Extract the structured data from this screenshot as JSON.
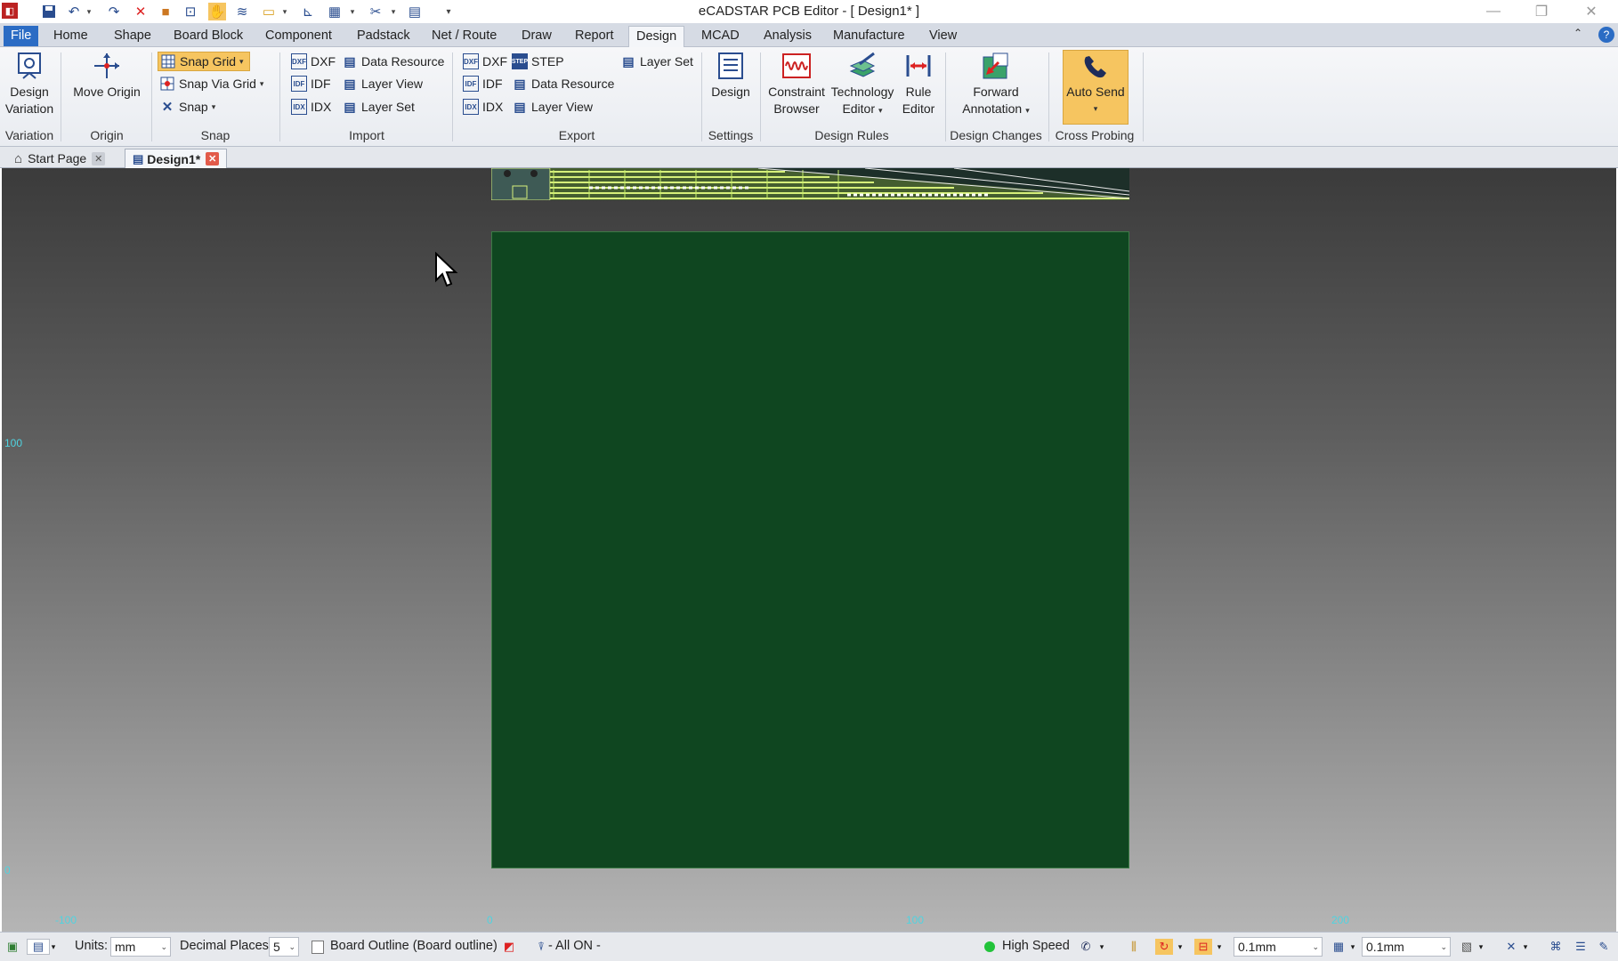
{
  "window": {
    "title": "eCADSTAR PCB Editor - [ Design1* ]"
  },
  "menu": [
    "File",
    "Home",
    "Shape",
    "Board Block",
    "Component",
    "Padstack",
    "Net / Route",
    "Draw",
    "Report",
    "Design",
    "MCAD",
    "Analysis",
    "Manufacture",
    "View"
  ],
  "active_menu": "Design",
  "ribbon": {
    "variation": {
      "button": "Design Variation",
      "button_l1": "Design",
      "button_l2": "Variation",
      "label": "Variation"
    },
    "origin": {
      "button": "Move Origin",
      "label": "Origin"
    },
    "snap": {
      "snap_grid": "Snap Grid",
      "snap_via_grid": "Snap Via Grid",
      "snap": "Snap",
      "label": "Snap"
    },
    "import": {
      "dxf": "DXF",
      "idf": "IDF",
      "idx": "IDX",
      "data_resource": "Data Resource",
      "layer_view": "Layer View",
      "layer_set": "Layer Set",
      "label": "Import"
    },
    "export": {
      "dxf": "DXF",
      "idf": "IDF",
      "idx": "IDX",
      "step": "STEP",
      "data_resource": "Data Resource",
      "layer_view": "Layer View",
      "layer_set": "Layer Set",
      "label": "Export"
    },
    "settings": {
      "design": "Design",
      "label": "Settings"
    },
    "design_rules": {
      "constraint_l1": "Constraint",
      "constraint_l2": "Browser",
      "technology_l1": "Technology",
      "technology_l2": "Editor",
      "rule_l1": "Rule",
      "rule_l2": "Editor",
      "label": "Design Rules"
    },
    "design_changes": {
      "forward_l1": "Forward",
      "forward_l2": "Annotation",
      "label": "Design Changes"
    },
    "cross_probing": {
      "auto_send": "Auto Send",
      "label": "Cross Probing"
    }
  },
  "tabs": [
    {
      "label": "Start Page"
    },
    {
      "label": "Design1*"
    }
  ],
  "canvas": {
    "y_labels": [
      "100",
      "0"
    ],
    "x_labels": [
      "-100",
      "0",
      "100",
      "200"
    ]
  },
  "statusbar": {
    "units_label": "Units:",
    "units_value": "mm",
    "decimal_label": "Decimal Places:",
    "decimal_value": "5",
    "layer": "Board Outline (Board outline)",
    "filter": "- All ON -",
    "high_speed": "High Speed",
    "grid1": "0.1mm",
    "grid2": "0.1mm"
  },
  "colors": {
    "board": "#0f4620",
    "accent": "#2b6cc4",
    "autosend": "#f6c560",
    "coord": "#4fd3e0"
  }
}
